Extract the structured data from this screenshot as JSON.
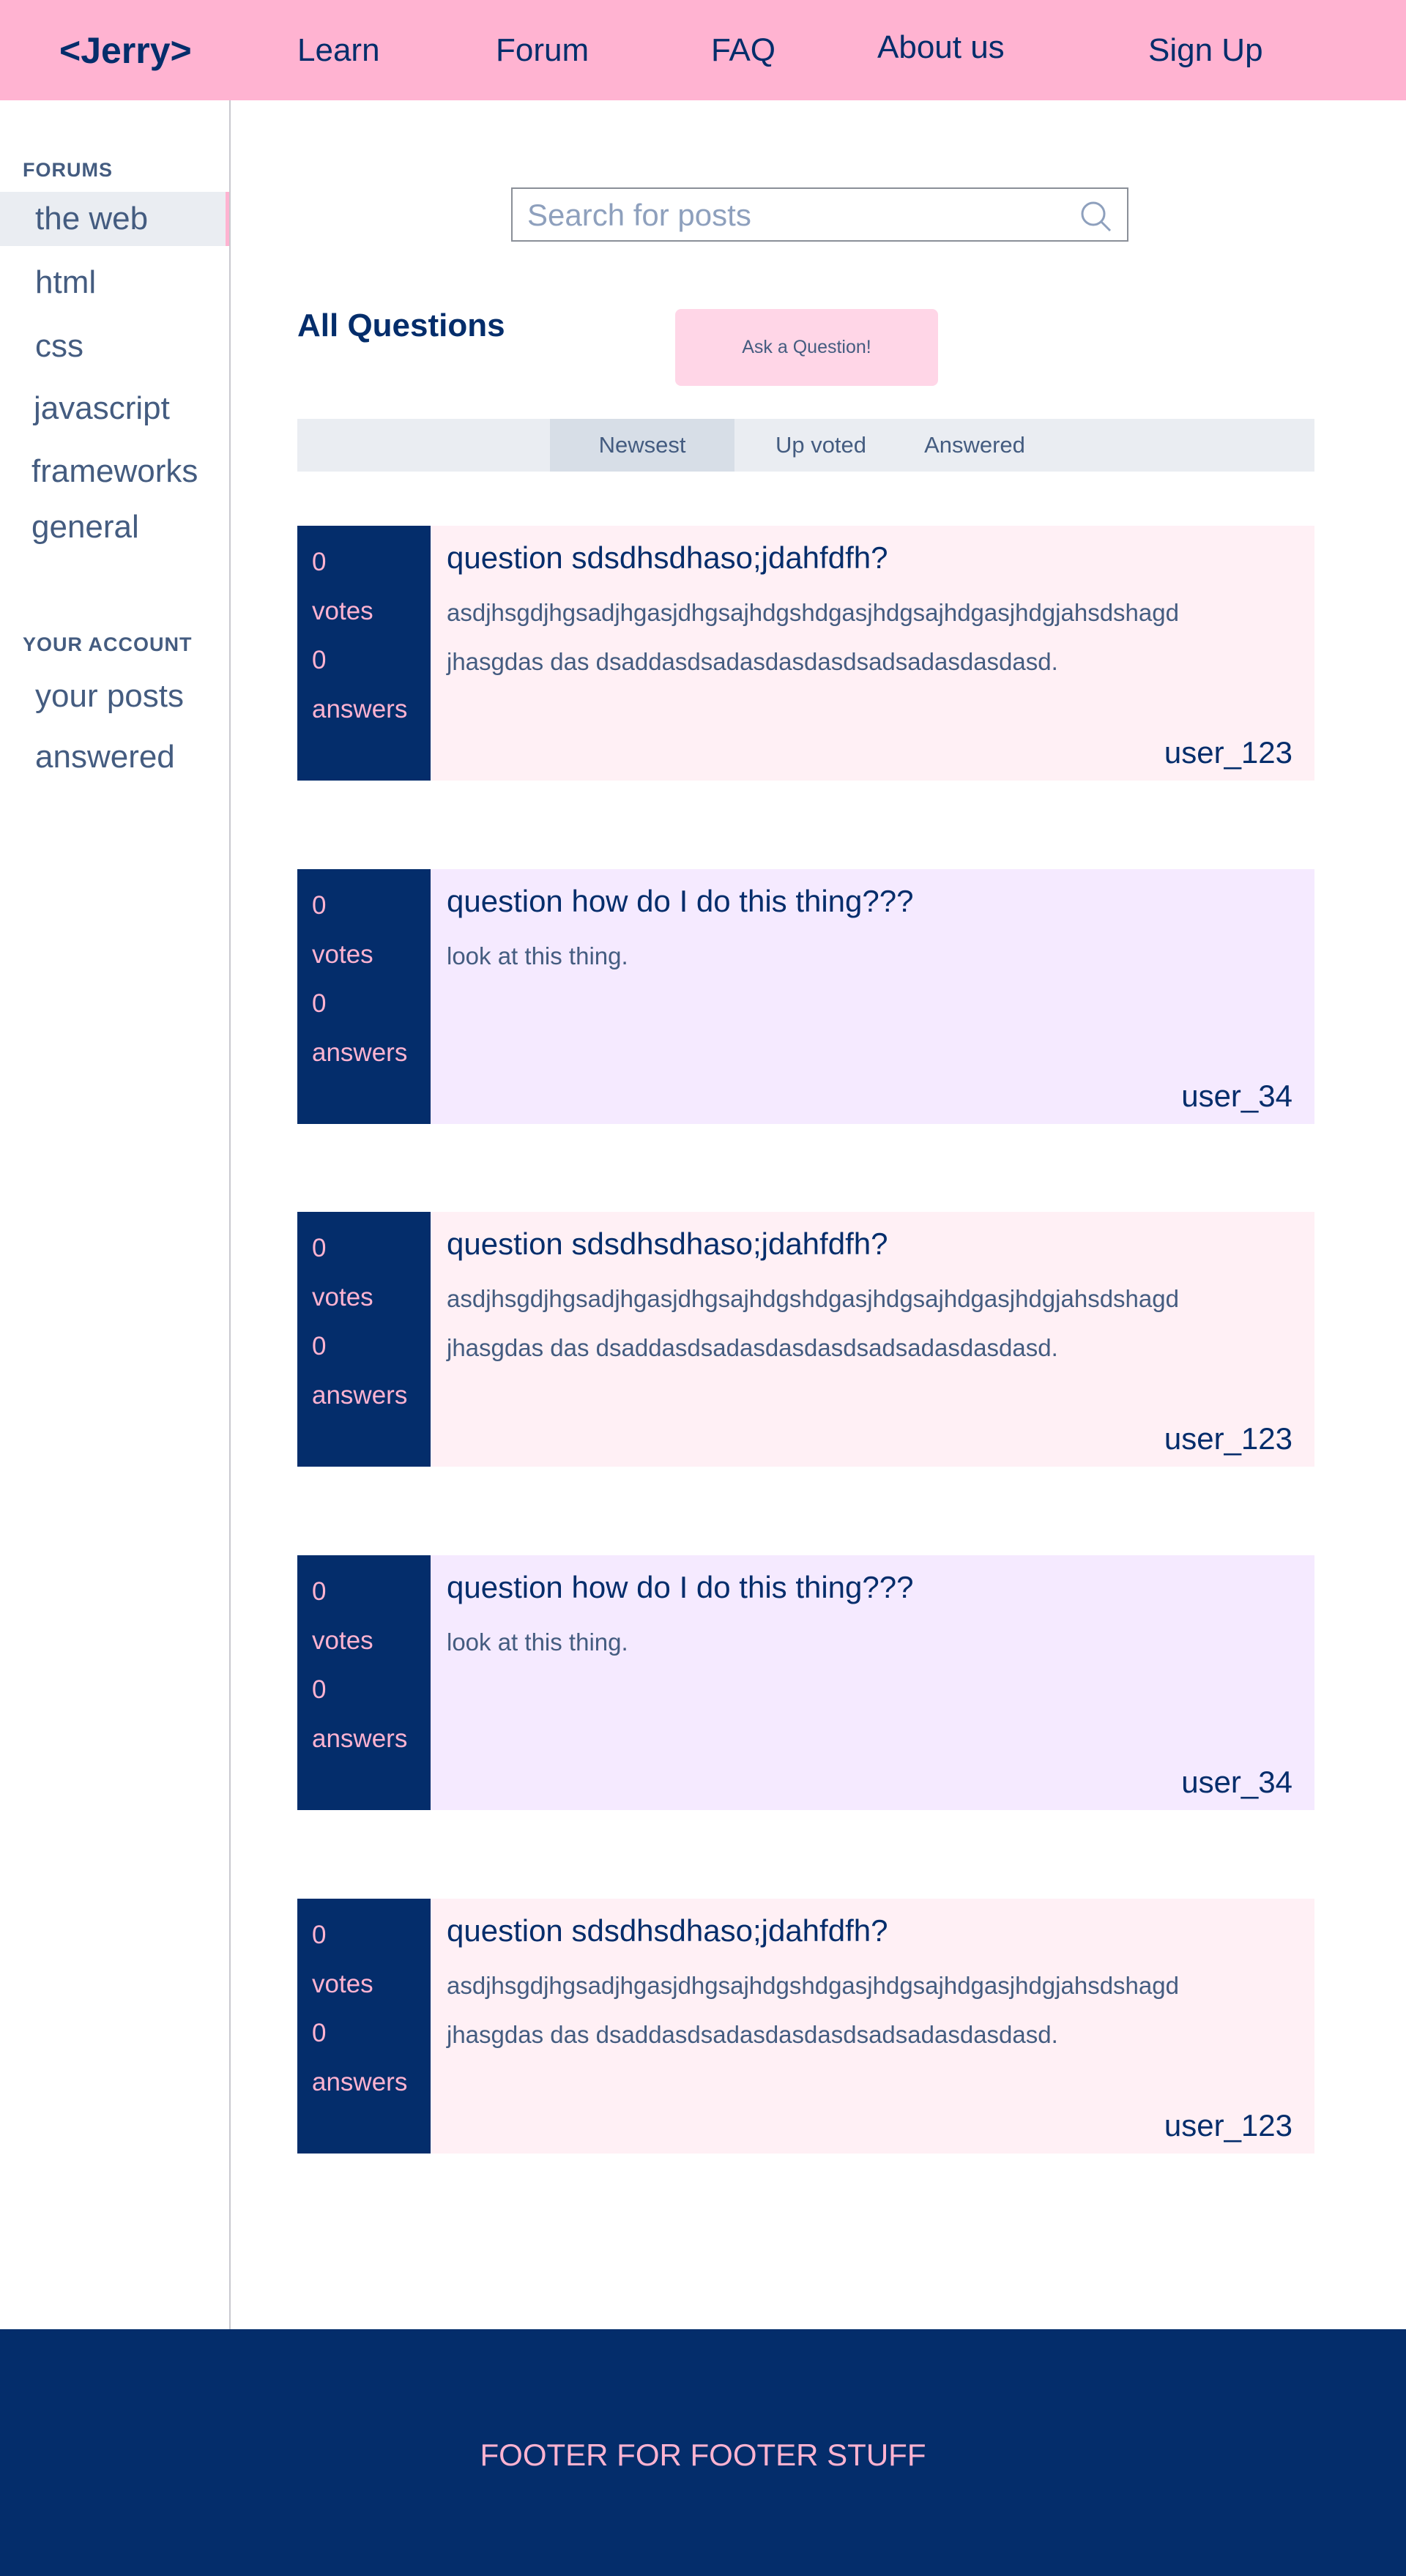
{
  "header": {
    "logo": "<Jerry>",
    "nav": [
      "Learn",
      "Forum",
      "FAQ",
      "About us",
      "Sign Up"
    ]
  },
  "sidebar": {
    "forums_label": "FORUMS",
    "forums": [
      "the web",
      "html",
      "css",
      "javascript",
      "frameworks",
      "general"
    ],
    "active": "the web",
    "account_label": "YOUR ACCOUNT",
    "account": [
      "your posts",
      "answered"
    ]
  },
  "search": {
    "placeholder": "Search for posts",
    "icon": "search-icon"
  },
  "main": {
    "title": "All Questions",
    "ask_label": "Ask a Question!",
    "tabs": [
      "Newsest",
      "Up voted",
      "Answered"
    ],
    "active_tab": "Newsest"
  },
  "posts": [
    {
      "votes": "0",
      "votes_label": "votes",
      "answers": "0",
      "answers_label": "answers",
      "title": "question sdsdhsdhaso;jdahfdfh?",
      "body": [
        "asdjhsgdjhgsadjhgasjdhgsajhdgshdgasjhdgsajhdgasjhdgjahsdshagd",
        "jhasgdas das dsaddasdsadasdasdasdsadsadasdasdasd."
      ],
      "user": "user_123"
    },
    {
      "votes": "0",
      "votes_label": "votes",
      "answers": "0",
      "answers_label": "answers",
      "title": "question how do I do this thing???",
      "body": [
        "look at this thing."
      ],
      "user": "user_34"
    },
    {
      "votes": "0",
      "votes_label": "votes",
      "answers": "0",
      "answers_label": "answers",
      "title": "question sdsdhsdhaso;jdahfdfh?",
      "body": [
        "asdjhsgdjhgsadjhgasjdhgsajhdgshdgasjhdgsajhdgasjhdgjahsdshagd",
        "jhasgdas das dsaddasdsadasdasdasdsadsadasdasdasd."
      ],
      "user": "user_123"
    },
    {
      "votes": "0",
      "votes_label": "votes",
      "answers": "0",
      "answers_label": "answers",
      "title": "question how do I do this thing???",
      "body": [
        "look at this thing."
      ],
      "user": "user_34"
    },
    {
      "votes": "0",
      "votes_label": "votes",
      "answers": "0",
      "answers_label": "answers",
      "title": "question sdsdhsdhaso;jdahfdfh?",
      "body": [
        "asdjhsgdjhgsadjhgasjdhgsajhdgshdgasjhdgsajhdgasjhdgjahsdshagd",
        "jhasgdas das dsaddasdsadasdasdasdsadsadasdasdasd."
      ],
      "user": "user_123"
    }
  ],
  "footer": {
    "text": "FOOTER FOR FOOTER STUFF"
  },
  "colors": {
    "header": "#ffb3d1",
    "navy": "#042d6b",
    "card_pink": "#fff0f5",
    "card_purple": "#f5eaff",
    "tab_bar": "#eaedf2",
    "ask_button": "#ffd6e7"
  }
}
